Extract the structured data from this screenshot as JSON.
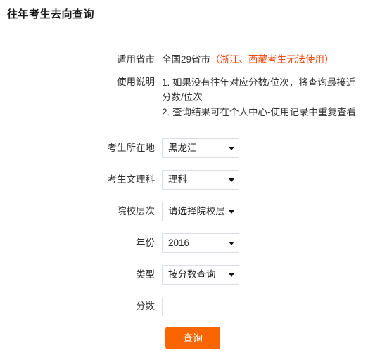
{
  "page": {
    "title": "往年考生去向查询"
  },
  "info": {
    "region_label": "适用省市",
    "region_value": "全国29省市",
    "region_warning": "（浙江、西藏考生无法使用）",
    "usage_label": "使用说明",
    "usage_lines": [
      "1. 如果没有往年对应分数/位次，将查询最接近",
      "分数/位次",
      "2. 查询结果可在个人中心-使用记录中重复查看"
    ]
  },
  "fields": {
    "location": {
      "label": "考生所在地",
      "value": "黑龙江",
      "icon": "chevron-down-icon"
    },
    "subject": {
      "label": "考生文理科",
      "value": "理科",
      "icon": "chevron-down-icon"
    },
    "school_level": {
      "label": "院校层次",
      "value": "请选择院校层次",
      "icon": "chevron-down-icon"
    },
    "year": {
      "label": "年份",
      "value": "2016",
      "icon": "chevron-down-icon"
    },
    "query_type": {
      "label": "类型",
      "value": "按分数查询",
      "icon": "chevron-down-icon"
    },
    "score": {
      "label": "分数",
      "value": "",
      "placeholder": ""
    }
  },
  "actions": {
    "submit_label": "查询"
  },
  "colors": {
    "warning": "#f4460c",
    "accent": "#f96500",
    "border": "#dadfe6",
    "text": "#333333"
  }
}
